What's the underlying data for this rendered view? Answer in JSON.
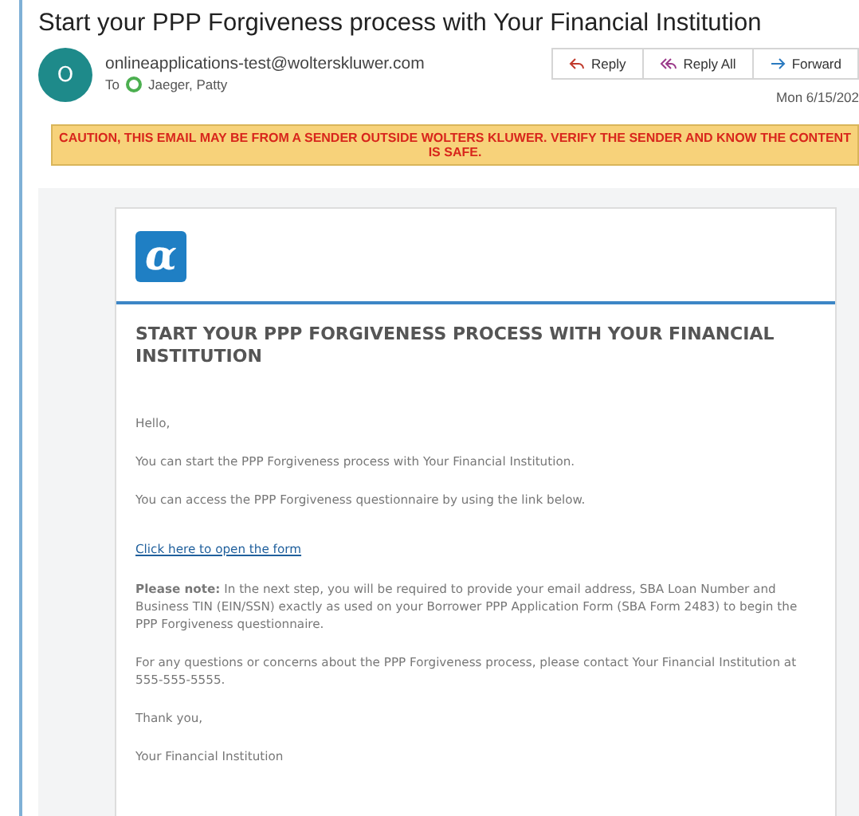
{
  "subject": "Start your PPP Forgiveness process with Your Financial Institution",
  "sender": {
    "initial": "O",
    "address": "onlineapplications-test@wolterskluwer.com",
    "to_label": "To",
    "recipient": "Jaeger, Patty"
  },
  "actions": [
    {
      "kind": "reply",
      "label": "Reply"
    },
    {
      "kind": "reply_all",
      "label": "Reply All"
    },
    {
      "kind": "forward",
      "label": "Forward"
    }
  ],
  "date": "Mon 6/15/202",
  "caution": "CAUTION, THIS EMAIL MAY BE FROM A SENDER OUTSIDE WOLTERS KLUWER. VERIFY THE SENDER AND KNOW THE CONTENT IS SAFE.",
  "email": {
    "logo": "α",
    "heading": "START YOUR PPP FORGIVENESS PROCESS WITH YOUR FINANCIAL INSTITUTION",
    "paragraphs": [
      {
        "kind": "text",
        "text": "Hello,"
      },
      {
        "kind": "text",
        "text": "You can start the PPP Forgiveness process with Your Financial Institution."
      },
      {
        "kind": "text",
        "text": "You can access the PPP Forgiveness questionnaire by using the link below."
      },
      {
        "kind": "link",
        "text": "Click here to open the form"
      },
      {
        "kind": "text",
        "text": "**Please note:** In the next step, you will be required to provide your email address, SBA Loan Number and Business TIN (EIN/SSN) exactly as used on your Borrower PPP Application Form (SBA Form 2483) to begin the PPP Forgiveness questionnaire."
      },
      {
        "kind": "text",
        "text": "For any questions or concerns about the PPP Forgiveness process, please contact Your Financial Institution at 555-555-5555."
      },
      {
        "kind": "text",
        "text": "Thank you,"
      },
      {
        "kind": "text",
        "text": "Your Financial Institution"
      }
    ]
  }
}
